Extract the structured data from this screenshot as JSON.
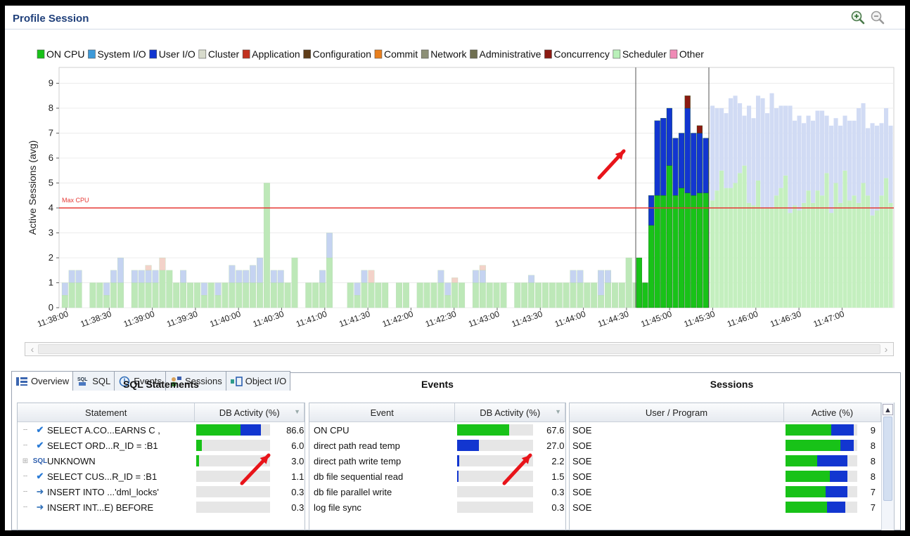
{
  "header": {
    "title": "Profile Session",
    "zoom_in_icon": "zoom-in-icon",
    "zoom_out_icon": "zoom-out-icon"
  },
  "chart_data": {
    "type": "bar",
    "stacked": true,
    "ylabel": "Active Sessions (avg)",
    "ylim": [
      0,
      10
    ],
    "yticks": [
      "0",
      "1",
      "2",
      "3",
      "4",
      "5",
      "6",
      "7",
      "8",
      "9"
    ],
    "xticks": [
      "11:38:00",
      "11:38:30",
      "11:39:00",
      "11:39:30",
      "11:40:00",
      "11:40:30",
      "11:41:00",
      "11:41:30",
      "11:42:00",
      "11:42:30",
      "11:43:00",
      "11:43:30",
      "11:44:00",
      "11:44:30",
      "11:45:00",
      "11:45:30",
      "11:46:00",
      "11:46:30",
      "11:47:00"
    ],
    "reference_line": {
      "label": "Max CPU",
      "value": 4,
      "color": "#e53935"
    },
    "selected_range": [
      "11:44:30",
      "11:45:00"
    ],
    "legend": [
      {
        "name": "ON CPU",
        "color": "#18c218"
      },
      {
        "name": "System I/O",
        "color": "#3d9ad9"
      },
      {
        "name": "User I/O",
        "color": "#1236d0"
      },
      {
        "name": "Cluster",
        "color": "#d8dbcc"
      },
      {
        "name": "Application",
        "color": "#c2311e"
      },
      {
        "name": "Configuration",
        "color": "#5e3c18"
      },
      {
        "name": "Commit",
        "color": "#e87f1e"
      },
      {
        "name": "Network",
        "color": "#8d9077"
      },
      {
        "name": "Administrative",
        "color": "#707051"
      },
      {
        "name": "Concurrency",
        "color": "#8b1a12"
      },
      {
        "name": "Scheduler",
        "color": "#b9f0b9"
      },
      {
        "name": "Other",
        "color": "#f08ab6"
      }
    ],
    "bars": [
      [
        0.5,
        0.5,
        0,
        0
      ],
      [
        1,
        0.5,
        0,
        0
      ],
      [
        1,
        0.5,
        0,
        0
      ],
      [
        0,
        0,
        0,
        0
      ],
      [
        1,
        0,
        0,
        0
      ],
      [
        1,
        0,
        0,
        0
      ],
      [
        0.5,
        0.5,
        0,
        0
      ],
      [
        1,
        0.5,
        0,
        0
      ],
      [
        1,
        1,
        0,
        0
      ],
      [
        0,
        0,
        0,
        0
      ],
      [
        1,
        0.5,
        0,
        0
      ],
      [
        1,
        0.5,
        0,
        0
      ],
      [
        1,
        0.5,
        0,
        0.2
      ],
      [
        1,
        0.5,
        0,
        0
      ],
      [
        1.5,
        0,
        0,
        0.5
      ],
      [
        1.5,
        0,
        0,
        0
      ],
      [
        1,
        0,
        0,
        0
      ],
      [
        1,
        0.5,
        0,
        0
      ],
      [
        1,
        0,
        0,
        0
      ],
      [
        1,
        0,
        0,
        0
      ],
      [
        0.5,
        0.5,
        0,
        0
      ],
      [
        1,
        0,
        0,
        0
      ],
      [
        0.5,
        0.5,
        0,
        0
      ],
      [
        1,
        0,
        0,
        0
      ],
      [
        1,
        0.7,
        0,
        0
      ],
      [
        1,
        0.5,
        0,
        0
      ],
      [
        1,
        0.5,
        0,
        0
      ],
      [
        1,
        0.7,
        0,
        0
      ],
      [
        1,
        1,
        0,
        0
      ],
      [
        5,
        0,
        0,
        0
      ],
      [
        1,
        0.5,
        0,
        0
      ],
      [
        1,
        0.5,
        0,
        0
      ],
      [
        1,
        0,
        0,
        0
      ],
      [
        2,
        0,
        0,
        0
      ],
      [
        0,
        0,
        0,
        0
      ],
      [
        1,
        0,
        0,
        0
      ],
      [
        1,
        0,
        0,
        0
      ],
      [
        1,
        0.5,
        0,
        0
      ],
      [
        2,
        1,
        0,
        0
      ],
      [
        0,
        0,
        0,
        0
      ],
      [
        0,
        0,
        0,
        0
      ],
      [
        1,
        0,
        0,
        0
      ],
      [
        0.5,
        0.5,
        0,
        0
      ],
      [
        1,
        0.5,
        0,
        0
      ],
      [
        1,
        0,
        0,
        0.5
      ],
      [
        1,
        0,
        0,
        0
      ],
      [
        1,
        0,
        0,
        0
      ],
      [
        0,
        0,
        0,
        0
      ],
      [
        1,
        0,
        0,
        0
      ],
      [
        1,
        0,
        0,
        0
      ],
      [
        0,
        0,
        0,
        0
      ],
      [
        1,
        0,
        0,
        0
      ],
      [
        1,
        0,
        0,
        0
      ],
      [
        1,
        0,
        0,
        0
      ],
      [
        1,
        0.5,
        0,
        0
      ],
      [
        0.5,
        0.5,
        0,
        0
      ],
      [
        1,
        0,
        0,
        0.2
      ],
      [
        1,
        0,
        0,
        0
      ],
      [
        0,
        0,
        0,
        0
      ],
      [
        1,
        0.5,
        0,
        0
      ],
      [
        1,
        0.5,
        0,
        0.2
      ],
      [
        1,
        0,
        0,
        0
      ],
      [
        1,
        0,
        0,
        0
      ],
      [
        1,
        0,
        0,
        0
      ],
      [
        0,
        0,
        0,
        0
      ],
      [
        1,
        0,
        0,
        0
      ],
      [
        1,
        0,
        0,
        0
      ],
      [
        1,
        0.3,
        0,
        0
      ],
      [
        1,
        0,
        0,
        0
      ],
      [
        1,
        0,
        0,
        0
      ],
      [
        1,
        0,
        0,
        0
      ],
      [
        1,
        0,
        0,
        0
      ],
      [
        1,
        0,
        0,
        0
      ],
      [
        1,
        0.5,
        0,
        0
      ],
      [
        1,
        0.5,
        0,
        0
      ],
      [
        1,
        0,
        0,
        0
      ],
      [
        1,
        0,
        0,
        0
      ],
      [
        0.5,
        1,
        0,
        0
      ],
      [
        1,
        0.5,
        0,
        0
      ],
      [
        1,
        0,
        0,
        0
      ],
      [
        1,
        0,
        0,
        0
      ],
      [
        2,
        0,
        0,
        0
      ],
      [
        1,
        0,
        0,
        0
      ],
      [
        1,
        0,
        0,
        0
      ],
      [
        0,
        0,
        0,
        0
      ]
    ],
    "active_bars": [
      [
        2,
        0,
        0
      ],
      [
        1,
        0,
        0
      ],
      [
        3.3,
        1.2,
        0
      ],
      [
        4.5,
        3,
        0
      ],
      [
        4.5,
        3.1,
        0
      ],
      [
        5.7,
        2.3,
        0
      ],
      [
        4.5,
        2.3,
        0
      ],
      [
        4.8,
        2.2,
        0
      ],
      [
        4.6,
        3.4,
        0.5
      ],
      [
        4.5,
        2.5,
        0
      ],
      [
        4.6,
        2.4,
        0.3
      ],
      [
        4.6,
        2.2,
        0
      ]
    ],
    "after_bars": [
      [
        4.3,
        3.8
      ],
      [
        4.7,
        3.3
      ],
      [
        5.5,
        2.5
      ],
      [
        4.8,
        3.0
      ],
      [
        4.8,
        3.6
      ],
      [
        5.0,
        3.5
      ],
      [
        5.4,
        2.8
      ],
      [
        5.7,
        2.0
      ],
      [
        4.2,
        3.9
      ],
      [
        4.1,
        3.5
      ],
      [
        5.1,
        3.4
      ],
      [
        4.0,
        4.4
      ],
      [
        4.0,
        3.8
      ],
      [
        4.0,
        4.6
      ],
      [
        4.5,
        3.5
      ],
      [
        4.8,
        3.3
      ],
      [
        5.3,
        2.8
      ],
      [
        3.8,
        4.3
      ],
      [
        4.1,
        3.4
      ],
      [
        3.9,
        3.8
      ],
      [
        4.2,
        3.2
      ],
      [
        4.7,
        3.0
      ],
      [
        4.2,
        3.3
      ],
      [
        4.7,
        3.2
      ],
      [
        4.5,
        3.4
      ],
      [
        5.4,
        2.3
      ],
      [
        3.8,
        3.5
      ],
      [
        5.0,
        2.6
      ],
      [
        4.2,
        3.1
      ],
      [
        5.5,
        2.2
      ],
      [
        4.3,
        3.2
      ],
      [
        4.5,
        3.0
      ],
      [
        4.2,
        3.8
      ],
      [
        5.0,
        3.2
      ],
      [
        4.5,
        2.7
      ],
      [
        3.7,
        3.7
      ],
      [
        3.9,
        3.4
      ],
      [
        4.5,
        2.9
      ],
      [
        5.2,
        2.8
      ],
      [
        4.2,
        3.1
      ]
    ]
  },
  "tabs": [
    {
      "label": "Overview",
      "icon": "overview-icon"
    },
    {
      "label": "SQL",
      "icon": "sql-icon"
    },
    {
      "label": "Events",
      "icon": "events-icon"
    },
    {
      "label": "Sessions",
      "icon": "sessions-icon"
    },
    {
      "label": "Object I/O",
      "icon": "object-io-icon"
    }
  ],
  "sql": {
    "title": "SQL Statements",
    "col_statement": "Statement",
    "col_activity": "DB Activity (%)",
    "rows": [
      {
        "statement": "SELECT A.CO...EARNS C ,",
        "value": "86.6",
        "green": 0.6,
        "blue": 0.27,
        "icon": "check"
      },
      {
        "statement": "SELECT ORD...R_ID = :B1",
        "value": "6.0",
        "green": 0.07,
        "blue": 0,
        "icon": "check"
      },
      {
        "statement": "UNKNOWN",
        "value": "3.0",
        "green": 0.03,
        "blue": 0,
        "icon": "sql"
      },
      {
        "statement": "SELECT CUS...R_ID = :B1",
        "value": "1.1",
        "green": 0,
        "blue": 0,
        "icon": "check"
      },
      {
        "statement": "INSERT INTO ...'dml_locks'",
        "value": "0.3",
        "green": 0,
        "blue": 0,
        "icon": "insert"
      },
      {
        "statement": "INSERT INT...E) BEFORE",
        "value": "0.3",
        "green": 0,
        "blue": 0,
        "icon": "insert"
      }
    ]
  },
  "events": {
    "title": "Events",
    "col_event": "Event",
    "col_activity": "DB Activity (%)",
    "rows": [
      {
        "event": "ON CPU",
        "value": "67.6",
        "color": "green",
        "fill": 0.68
      },
      {
        "event": "direct path read temp",
        "value": "27.0",
        "color": "blue",
        "fill": 0.28
      },
      {
        "event": "direct path write temp",
        "value": "2.2",
        "color": "blue",
        "fill": 0.02
      },
      {
        "event": "db file sequential read",
        "value": "1.5",
        "color": "blue",
        "fill": 0.015
      },
      {
        "event": "db file parallel write",
        "value": "0.3",
        "color": "blue",
        "fill": 0
      },
      {
        "event": "log file sync",
        "value": "0.3",
        "color": "blue",
        "fill": 0
      }
    ]
  },
  "sessions": {
    "title": "Sessions",
    "col_user": "User / Program",
    "col_active": "Active (%)",
    "rows": [
      {
        "user": "SOE",
        "value": "9",
        "green": 0.64,
        "blue": 0.31
      },
      {
        "user": "SOE",
        "value": "8",
        "green": 0.76,
        "blue": 0.19
      },
      {
        "user": "SOE",
        "value": "8",
        "green": 0.44,
        "blue": 0.42
      },
      {
        "user": "SOE",
        "value": "8",
        "green": 0.62,
        "blue": 0.24
      },
      {
        "user": "SOE",
        "value": "7",
        "green": 0.56,
        "blue": 0.3
      },
      {
        "user": "SOE",
        "value": "7",
        "green": 0.58,
        "blue": 0.25
      }
    ]
  }
}
